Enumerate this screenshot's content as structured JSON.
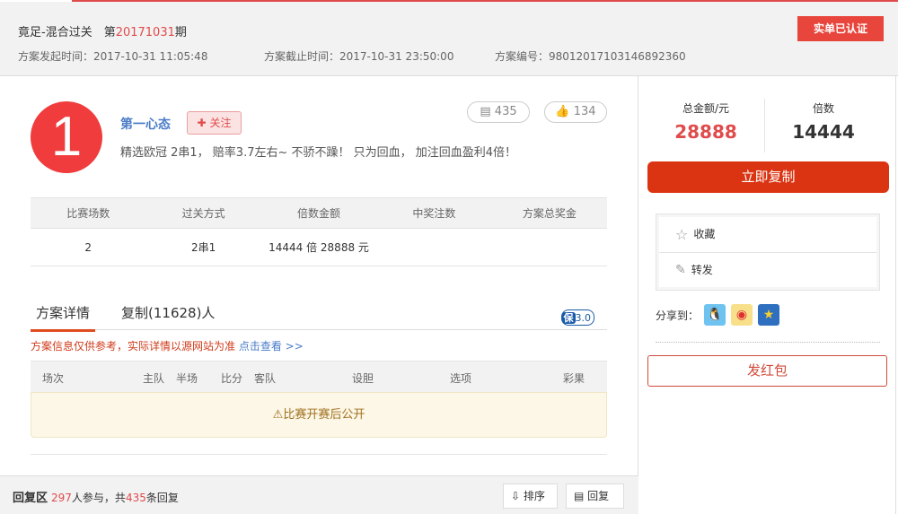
{
  "header": {
    "title_prefix": "竟足-混合过关　第",
    "issue": "20171031",
    "title_suffix": "期",
    "start_time": "方案发起时间：2017-10-31 11:05:48",
    "end_time": "方案截止时间：2017-10-31 23:50:00",
    "plan_no": "方案编号：98012017103146892360",
    "cert_label": "实单已认证"
  },
  "user": {
    "rank": "1",
    "name": "第一心态",
    "follow_label": "关注",
    "description": "精选欧冠 2串1， 赔率3.7左右~ 不骄不躁！ 只为回血， 加注回血盈利4倍！",
    "comments": "435",
    "likes": "134"
  },
  "summary": {
    "headers": [
      "比赛场数",
      "过关方式",
      "倍数金额",
      "中奖注数",
      "方案总奖金"
    ],
    "row": [
      "2",
      "2串1",
      "14444 倍  28888 元",
      "",
      ""
    ]
  },
  "tabs": {
    "detail": "方案详情",
    "copy": "复制(11628)人",
    "badge_prefix": "保",
    "badge_ver": "3.0"
  },
  "notice": {
    "text": "方案信息仅供参考，实际详情以源网站为准 ",
    "link": "点击查看 >>"
  },
  "matches": {
    "headers": [
      "场次",
      "主队",
      "半场",
      "比分",
      "客队",
      "设胆",
      "选项",
      "彩果"
    ],
    "empty": "比赛开赛后公开"
  },
  "reply": {
    "title": "回复区",
    "participants": "297",
    "mid": "人参与，共",
    "count": "435",
    "suffix": "条回复",
    "sort_label": "排序",
    "reply_label": "回复"
  },
  "side": {
    "total_label": "总金额/元",
    "total": "28888",
    "multiple_label": "倍数",
    "multiple": "14444",
    "copy_label": "立即复制",
    "fav_label": "收藏",
    "forward_label": "转发",
    "share_label": "分享到：",
    "redpacket_label": "发红包"
  }
}
